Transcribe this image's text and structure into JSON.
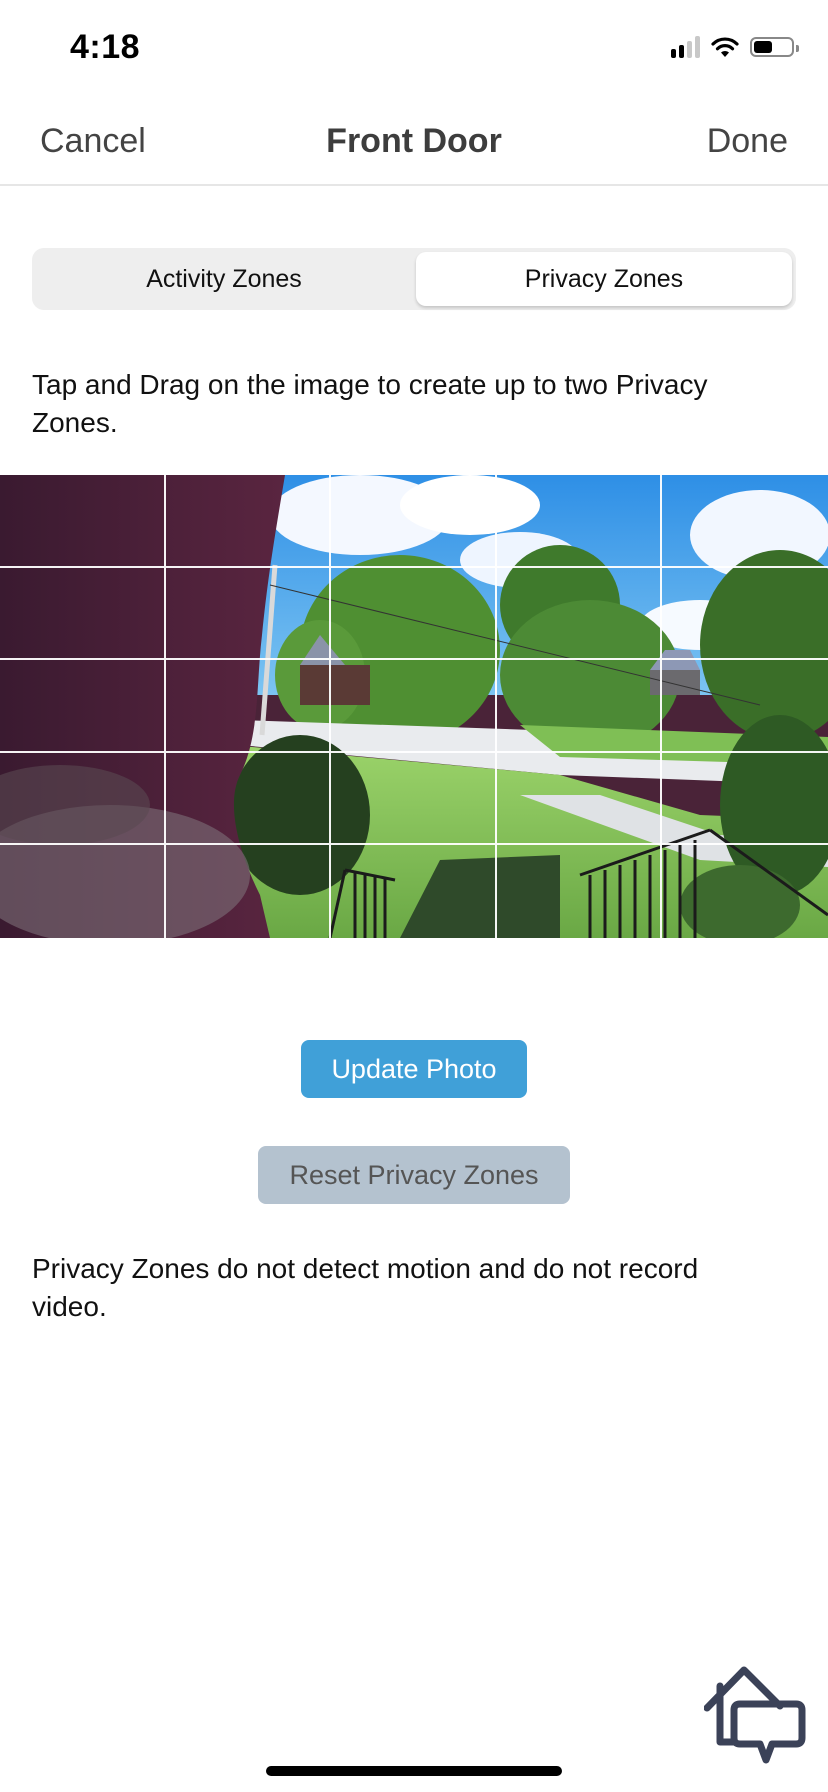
{
  "status_bar": {
    "time": "4:18",
    "signal_bars_active": 2,
    "signal_bars_total": 4,
    "battery_level": 0.5,
    "icons": [
      "cellular-signal-icon",
      "wifi-icon",
      "battery-icon"
    ]
  },
  "nav": {
    "cancel_label": "Cancel",
    "title": "Front Door",
    "done_label": "Done"
  },
  "segmented_control": {
    "tabs": [
      {
        "label": "Activity Zones",
        "active": false
      },
      {
        "label": "Privacy Zones",
        "active": true
      }
    ]
  },
  "instructions": "Tap and Drag on the image to create up to two Privacy Zones.",
  "snapshot": {
    "description": "Front door camera snapshot: brick wall on left, lawn, street, trees, houses, blue sky with clouds",
    "grid_rows": 5,
    "grid_cols": 5
  },
  "buttons": {
    "update_photo": "Update Photo",
    "reset_privacy_zones": "Reset Privacy Zones"
  },
  "footnote": "Privacy Zones do not detect motion and do not record video.",
  "help": {
    "icon": "home-chat-icon"
  },
  "colors": {
    "primary_button": "#40a0d8",
    "disabled_button": "#b4c2cf",
    "help_icon": "#3b4258",
    "segment_bg": "#eeeeee"
  }
}
